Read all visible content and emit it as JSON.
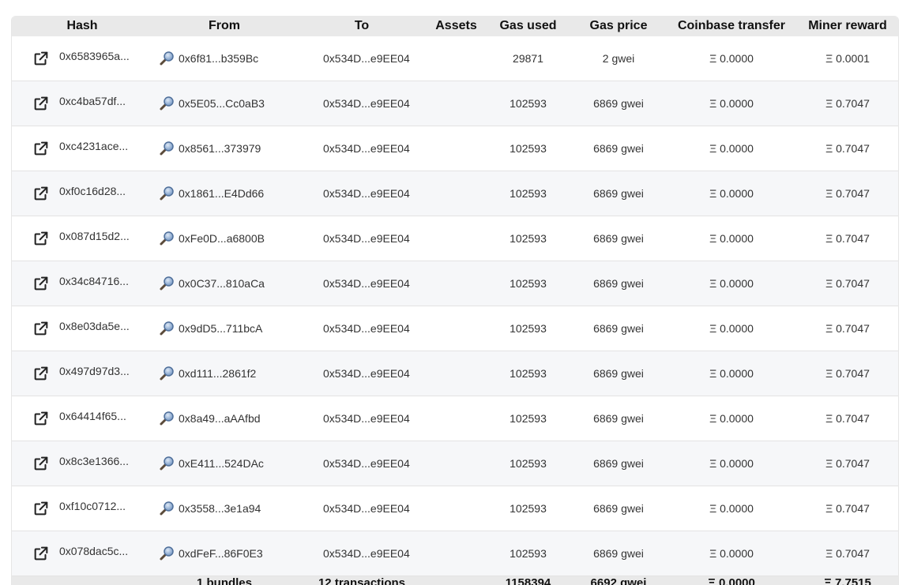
{
  "columns": [
    "Hash",
    "From",
    "To",
    "Assets",
    "Gas used",
    "Gas price",
    "Coinbase transfer",
    "Miner reward"
  ],
  "icons": {
    "hash": "external-link-icon",
    "from": "magnifier-icon"
  },
  "rows": [
    {
      "hash": "0x6583965a...",
      "from": "0x6f81...b359Bc",
      "to": "0x534D...e9EE04",
      "assets": "",
      "gas_used": "29871",
      "gas_price": "2 gwei",
      "coinbase": "Ξ 0.0000",
      "reward": "Ξ 0.0001"
    },
    {
      "hash": "0xc4ba57df...",
      "from": "0x5E05...Cc0aB3",
      "to": "0x534D...e9EE04",
      "assets": "",
      "gas_used": "102593",
      "gas_price": "6869 gwei",
      "coinbase": "Ξ 0.0000",
      "reward": "Ξ 0.7047"
    },
    {
      "hash": "0xc4231ace...",
      "from": "0x8561...373979",
      "to": "0x534D...e9EE04",
      "assets": "",
      "gas_used": "102593",
      "gas_price": "6869 gwei",
      "coinbase": "Ξ 0.0000",
      "reward": "Ξ 0.7047"
    },
    {
      "hash": "0xf0c16d28...",
      "from": "0x1861...E4Dd66",
      "to": "0x534D...e9EE04",
      "assets": "",
      "gas_used": "102593",
      "gas_price": "6869 gwei",
      "coinbase": "Ξ 0.0000",
      "reward": "Ξ 0.7047"
    },
    {
      "hash": "0x087d15d2...",
      "from": "0xFe0D...a6800B",
      "to": "0x534D...e9EE04",
      "assets": "",
      "gas_used": "102593",
      "gas_price": "6869 gwei",
      "coinbase": "Ξ 0.0000",
      "reward": "Ξ 0.7047"
    },
    {
      "hash": "0x34c84716...",
      "from": "0x0C37...810aCa",
      "to": "0x534D...e9EE04",
      "assets": "",
      "gas_used": "102593",
      "gas_price": "6869 gwei",
      "coinbase": "Ξ 0.0000",
      "reward": "Ξ 0.7047"
    },
    {
      "hash": "0x8e03da5e...",
      "from": "0x9dD5...711bcA",
      "to": "0x534D...e9EE04",
      "assets": "",
      "gas_used": "102593",
      "gas_price": "6869 gwei",
      "coinbase": "Ξ 0.0000",
      "reward": "Ξ 0.7047"
    },
    {
      "hash": "0x497d97d3...",
      "from": "0xd111...2861f2",
      "to": "0x534D...e9EE04",
      "assets": "",
      "gas_used": "102593",
      "gas_price": "6869 gwei",
      "coinbase": "Ξ 0.0000",
      "reward": "Ξ 0.7047"
    },
    {
      "hash": "0x64414f65...",
      "from": "0x8a49...aAAfbd",
      "to": "0x534D...e9EE04",
      "assets": "",
      "gas_used": "102593",
      "gas_price": "6869 gwei",
      "coinbase": "Ξ 0.0000",
      "reward": "Ξ 0.7047"
    },
    {
      "hash": "0x8c3e1366...",
      "from": "0xE411...524DAc",
      "to": "0x534D...e9EE04",
      "assets": "",
      "gas_used": "102593",
      "gas_price": "6869 gwei",
      "coinbase": "Ξ 0.0000",
      "reward": "Ξ 0.7047"
    },
    {
      "hash": "0xf10c0712...",
      "from": "0x3558...3e1a94",
      "to": "0x534D...e9EE04",
      "assets": "",
      "gas_used": "102593",
      "gas_price": "6869 gwei",
      "coinbase": "Ξ 0.0000",
      "reward": "Ξ 0.7047"
    },
    {
      "hash": "0x078dac5c...",
      "from": "0xdFeF...86F0E3",
      "to": "0x534D...e9EE04",
      "assets": "",
      "gas_used": "102593",
      "gas_price": "6869 gwei",
      "coinbase": "Ξ 0.0000",
      "reward": "Ξ 0.7047"
    }
  ],
  "footer": {
    "bundles": "1 bundles",
    "transactions": "12 transactions",
    "gas_used": "1158394",
    "gas_price": "6692 gwei",
    "coinbase": "Ξ 0.0000",
    "reward": "Ξ 7.7515"
  }
}
